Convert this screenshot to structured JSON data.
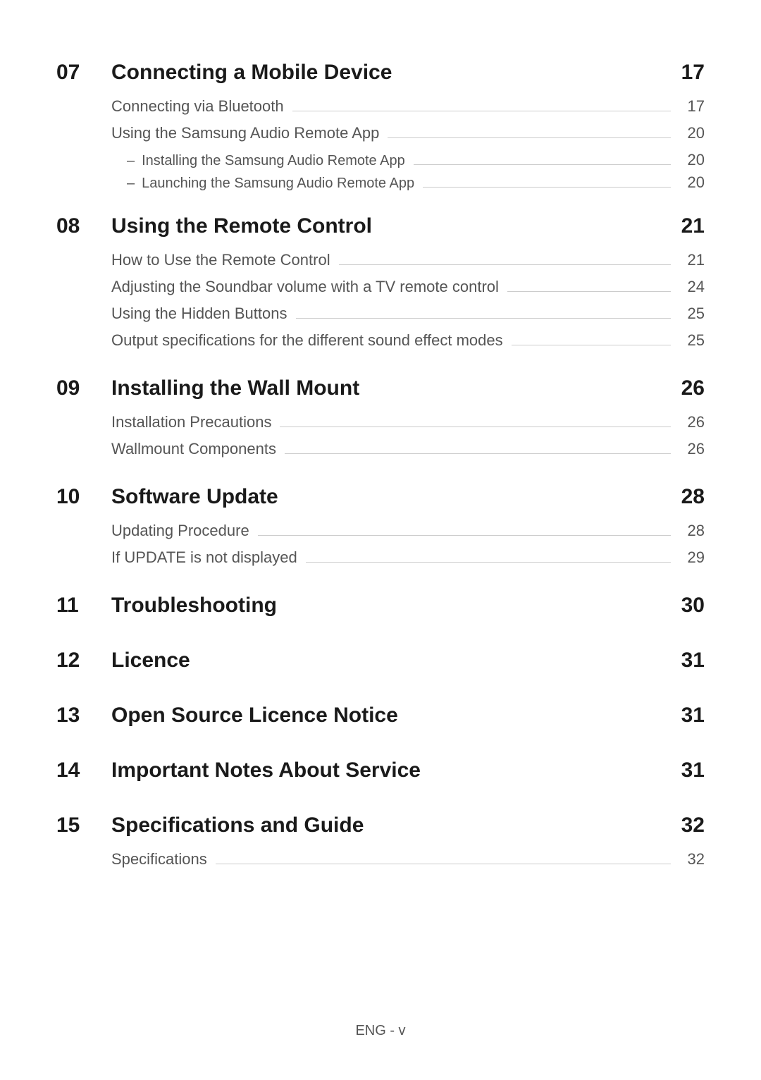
{
  "footer": "ENG - v",
  "sections": [
    {
      "num": "07",
      "title": "Connecting a Mobile Device",
      "page": "17",
      "items": [
        {
          "text": "Connecting via Bluetooth",
          "page": "17"
        },
        {
          "text": "Using the Samsung Audio Remote App",
          "page": "20",
          "sub": [
            {
              "text": "Installing the Samsung Audio Remote App",
              "page": "20"
            },
            {
              "text": "Launching the Samsung Audio Remote App",
              "page": "20"
            }
          ]
        }
      ]
    },
    {
      "num": "08",
      "title": "Using the Remote Control",
      "page": "21",
      "items": [
        {
          "text": "How to Use the Remote Control",
          "page": "21"
        },
        {
          "text": "Adjusting the Soundbar volume with a TV remote control",
          "page": "24"
        },
        {
          "text": "Using the Hidden Buttons",
          "page": "25"
        },
        {
          "text": "Output specifications for the different sound effect modes",
          "page": "25"
        }
      ]
    },
    {
      "num": "09",
      "title": "Installing the Wall Mount",
      "page": "26",
      "items": [
        {
          "text": "Installation Precautions",
          "page": "26"
        },
        {
          "text": "Wallmount Components",
          "page": "26"
        }
      ]
    },
    {
      "num": "10",
      "title": "Software Update",
      "page": "28",
      "items": [
        {
          "text": "Updating Procedure",
          "page": "28"
        },
        {
          "text": "If UPDATE is not displayed",
          "page": "29"
        }
      ]
    },
    {
      "num": "11",
      "title": "Troubleshooting",
      "page": "30",
      "items": []
    },
    {
      "num": "12",
      "title": "Licence",
      "page": "31",
      "items": []
    },
    {
      "num": "13",
      "title": "Open Source Licence Notice",
      "page": "31",
      "items": []
    },
    {
      "num": "14",
      "title": "Important Notes About Service",
      "page": "31",
      "items": []
    },
    {
      "num": "15",
      "title": "Specifications and Guide",
      "page": "32",
      "items": [
        {
          "text": "Specifications",
          "page": "32"
        }
      ]
    }
  ]
}
